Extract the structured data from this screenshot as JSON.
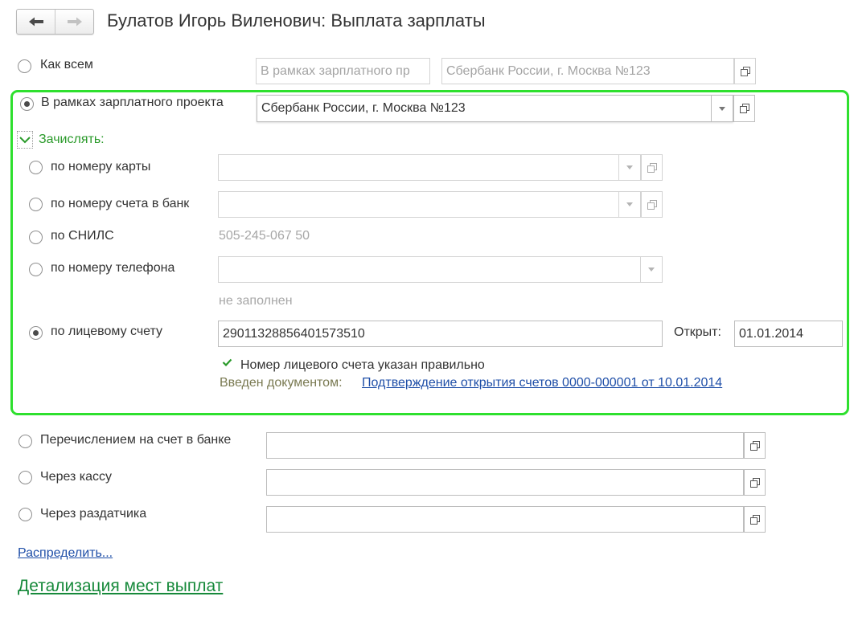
{
  "header": {
    "title": "Булатов Игорь Виленович: Выплата зарплаты"
  },
  "options": {
    "as_all": {
      "label": "Как всем",
      "field1": "В рамках зарплатного пр",
      "field2": "Сбербанк России, г. Москва №123"
    },
    "salary_project": {
      "label": "В рамках зарплатного проекта",
      "value": "Сбербанк России, г. Москва №123"
    },
    "transfer_bank": {
      "label": "Перечислением на счет в банке",
      "value": ""
    },
    "cash_desk": {
      "label": "Через кассу",
      "value": ""
    },
    "distributor": {
      "label": "Через раздатчика",
      "value": ""
    }
  },
  "credit": {
    "header": "Зачислять:",
    "card": {
      "label": "по номеру карты",
      "value": ""
    },
    "bank_account": {
      "label": "по номеру счета в банк",
      "value": ""
    },
    "snils": {
      "label": "по СНИЛС",
      "value": "505-245-067 50"
    },
    "phone": {
      "label": "по номеру телефона",
      "value": "",
      "note": "не заполнен"
    },
    "personal_account": {
      "label": "по лицевому счету",
      "value": "29011328856401573510",
      "opened_label": "Открыт:",
      "opened_date": "01.01.2014",
      "valid_message": "Номер лицевого счета указан правильно",
      "entered_by_label": "Введен документом:",
      "entered_by_link": "Подтверждение открытия счетов 0000-000001 от 10.01.2014"
    }
  },
  "links": {
    "distribute": "Распределить...",
    "details": "Детализация мест выплат"
  },
  "colors": {
    "highlight_border": "#2ee02e",
    "accent_green": "#2a9a2a",
    "link_blue": "#1f4fa8"
  }
}
